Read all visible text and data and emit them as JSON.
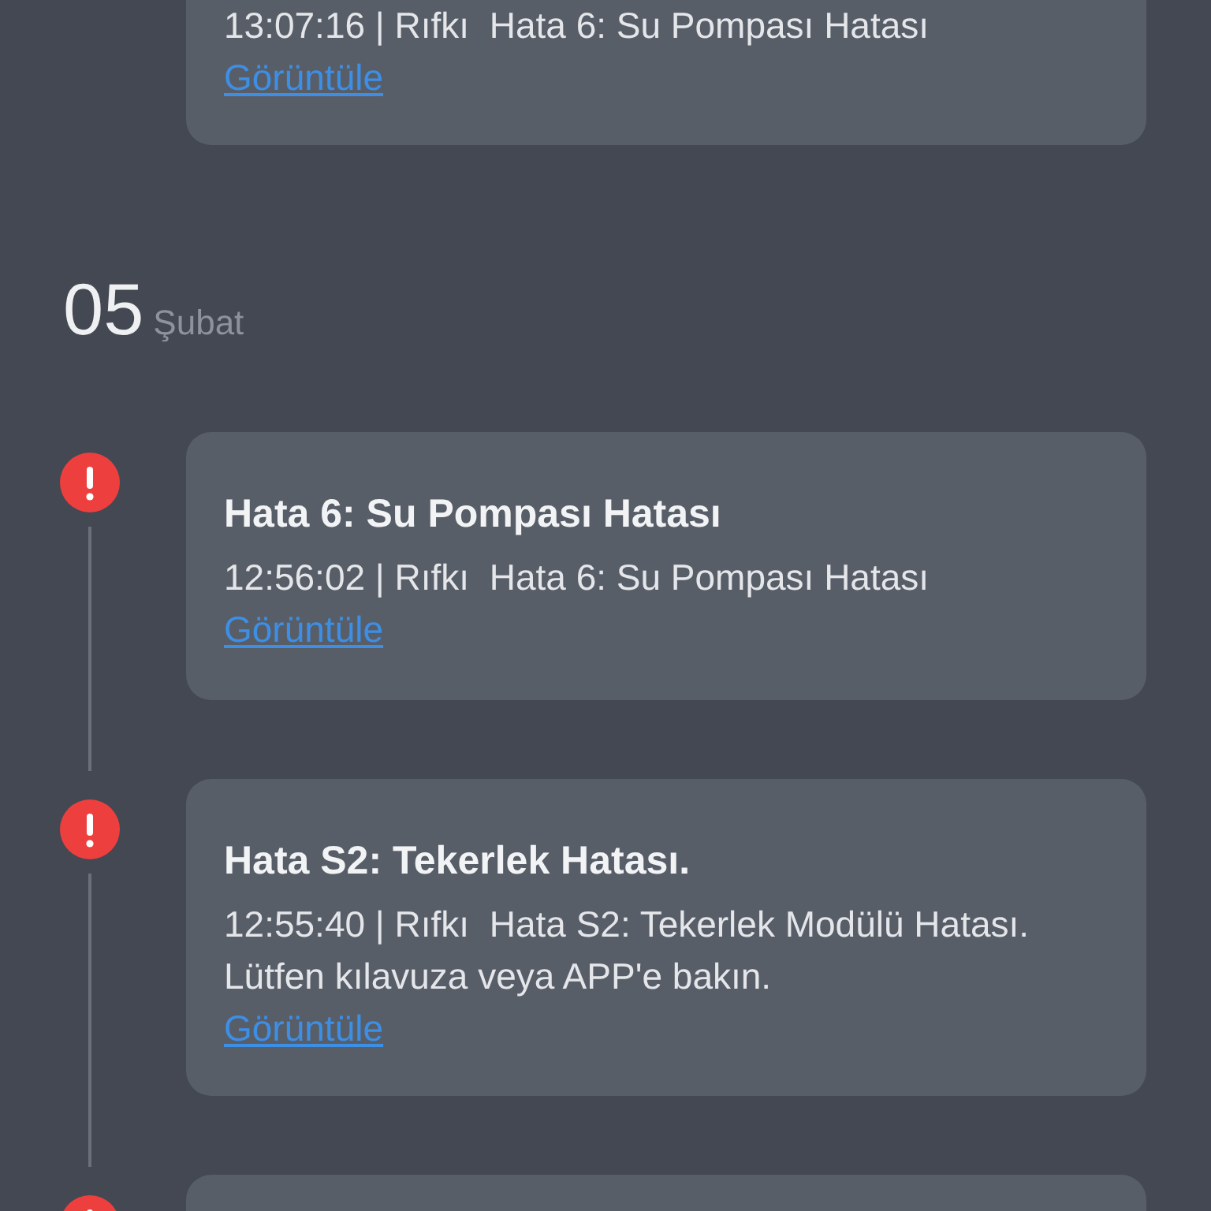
{
  "top_card": {
    "meta": "13:07:16 | Rıfkı  Hata 6: Su Pompası Hatası",
    "link": "Görüntüle"
  },
  "date_header": {
    "day": "05",
    "month": "Şubat"
  },
  "events": [
    {
      "kind": "error",
      "title": "Hata 6: Su Pompası Hatası",
      "meta": "12:56:02 | Rıfkı  Hata 6: Su Pompası Hatası",
      "link": "Görüntüle"
    },
    {
      "kind": "error",
      "title": "Hata S2: Tekerlek Hatası.",
      "meta": "12:55:40 | Rıfkı  Hata S2: Tekerlek Modülü Hatası. Lütfen kılavuza veya APP'e bakın.",
      "link": "Görüntüle"
    },
    {
      "kind": "error"
    }
  ]
}
